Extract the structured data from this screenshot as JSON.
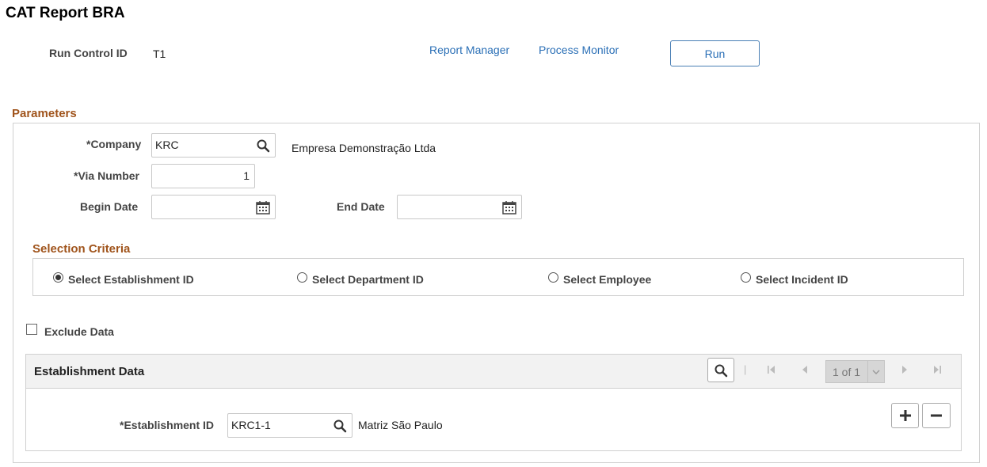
{
  "page": {
    "title": "CAT Report BRA"
  },
  "run_control": {
    "label": "Run Control ID",
    "value": "T1",
    "report_manager_link": "Report Manager",
    "process_monitor_link": "Process Monitor",
    "run_button": "Run"
  },
  "parameters": {
    "section_title": "Parameters",
    "company": {
      "label": "*Company",
      "value": "KRC",
      "description": "Empresa Demonstração Ltda",
      "icon": "search-icon"
    },
    "via_number": {
      "label": "*Via Number",
      "value": "1"
    },
    "begin_date": {
      "label": "Begin Date",
      "value": "",
      "icon": "calendar-icon"
    },
    "end_date": {
      "label": "End Date",
      "value": "",
      "icon": "calendar-icon"
    }
  },
  "selection_criteria": {
    "title": "Selection Criteria",
    "options": [
      {
        "label": "Select Establishment ID",
        "selected": true
      },
      {
        "label": "Select Department ID",
        "selected": false
      },
      {
        "label": "Select Employee",
        "selected": false
      },
      {
        "label": "Select Incident ID",
        "selected": false
      }
    ]
  },
  "exclude_data": {
    "label": "Exclude Data",
    "checked": false
  },
  "establishment_grid": {
    "title": "Establishment Data",
    "pagination": "1 of 1",
    "row": {
      "label": "*Establishment ID",
      "value": "KRC1-1",
      "description": "Matriz São Paulo"
    },
    "add_icon": "plus-icon",
    "delete_icon": "minus-icon"
  },
  "colors": {
    "section_title": "#a0541c",
    "link": "#2a6fb6",
    "border": "#d0d0d0"
  }
}
